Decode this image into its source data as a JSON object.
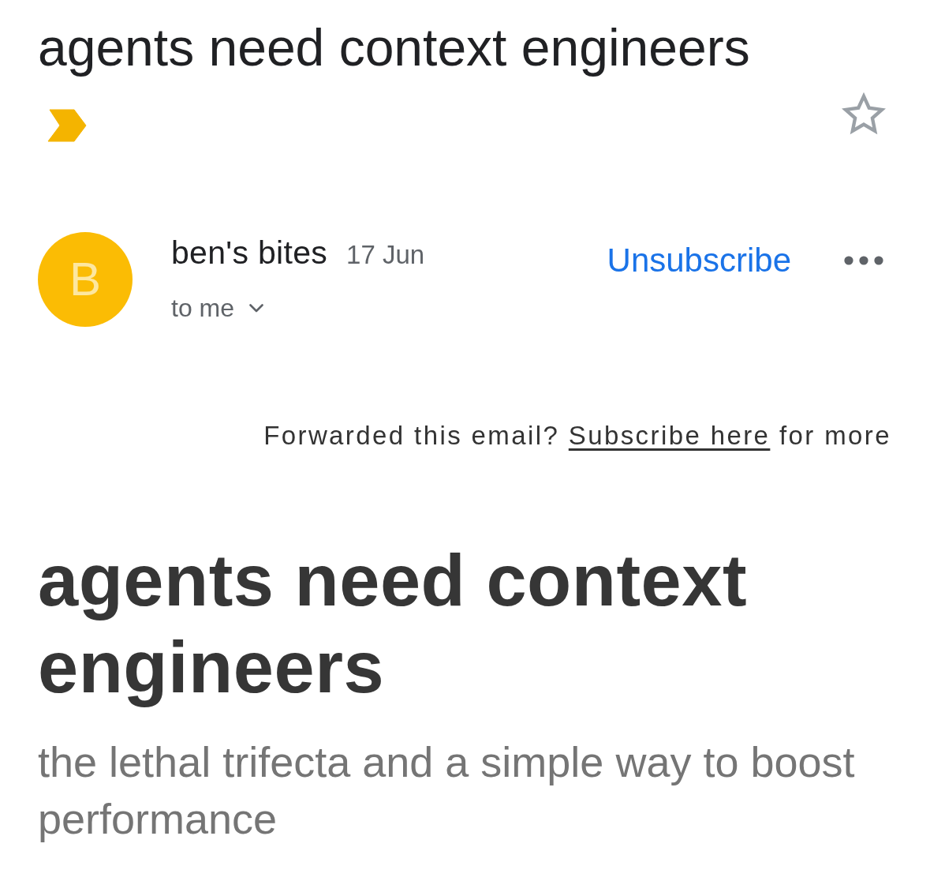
{
  "subject": {
    "title": "agents need context engineers",
    "important": true,
    "starred": false
  },
  "sender": {
    "initial": "B",
    "name": "ben's bites",
    "date": "17 Jun",
    "recipient": "to me",
    "unsubscribe": "Unsubscribe"
  },
  "body": {
    "forward_note": {
      "before": "Forwarded this email?",
      "link": "Subscribe here",
      "after": "for more"
    },
    "heading": "agents need context engineers",
    "subtitle": "the lethal trifecta and a simple way to boost performance"
  }
}
